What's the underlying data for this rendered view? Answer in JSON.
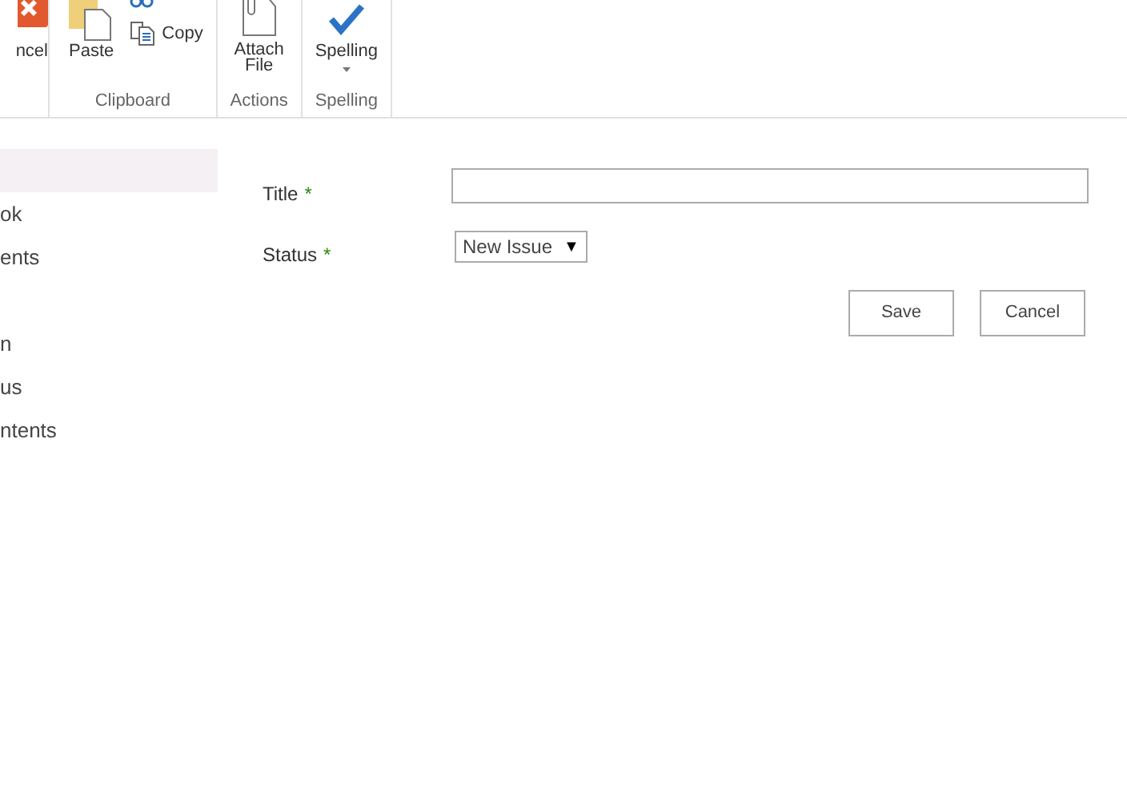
{
  "ribbon": {
    "groups": [
      {
        "kind": "commit",
        "buttons": [
          {
            "label": "ncel"
          }
        ]
      },
      {
        "kind": "clipboard",
        "buttons": [
          {
            "label": "Paste"
          },
          {
            "label": "Copy"
          }
        ],
        "label": "Clipboard"
      },
      {
        "kind": "actions",
        "buttons": [
          {
            "label": "Attach File"
          }
        ],
        "label": "Actions"
      },
      {
        "kind": "spelling",
        "buttons": [
          {
            "label": "Spelling"
          }
        ],
        "label": "Spelling"
      }
    ]
  },
  "sidebar": {
    "groups": [
      {
        "items": [
          {
            "selected": true
          },
          {
            "label": "ok",
            "selected": false
          },
          {
            "label": "ents",
            "selected": false
          }
        ]
      },
      {
        "items": [
          {
            "label": "n",
            "selected": false
          },
          {
            "label": "us",
            "selected": false
          },
          {
            "label": "ntents",
            "selected": false
          }
        ]
      }
    ]
  },
  "form": {
    "fields": [
      {
        "kind": "text",
        "label": "Title",
        "required_mark": "*"
      },
      {
        "kind": "select",
        "label": "Status",
        "required_mark": "*",
        "value": "New Issue",
        "arrow": "▼"
      }
    ],
    "buttons": [
      "Save",
      "Cancel"
    ]
  }
}
